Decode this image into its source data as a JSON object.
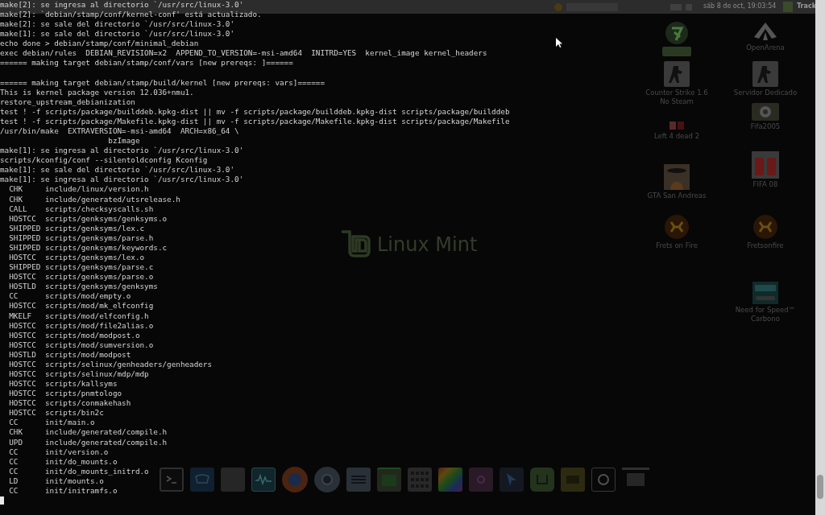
{
  "top_panel": {
    "clock": "sáb 8 de oct, 19:03:54",
    "window_button": "Track"
  },
  "desktop": {
    "logo_text": "Linux Mint",
    "icons": [
      {
        "selected": true,
        "kind": "green"
      },
      {
        "label": "OpenArena",
        "selected": false,
        "kind": "arena"
      },
      {
        "label": "Counter Strike 1.6\nNo Steam",
        "selected": false,
        "kind": "soldier"
      },
      {
        "label": "Servidor Dedicado",
        "selected": false,
        "kind": "soldier"
      },
      {
        "label": "Fifa2005",
        "selected": false,
        "kind": "ball"
      },
      {
        "label": "Left 4 dead 2",
        "selected": false,
        "kind": "l4d"
      },
      {
        "label": "FIFA 08",
        "selected": false,
        "kind": "fifa"
      },
      {
        "label": "GTA San Andreas",
        "selected": false,
        "kind": "gta"
      },
      {
        "label": "Frets on Fire",
        "selected": false,
        "kind": "frets"
      },
      {
        "label": "Fretsonfire",
        "selected": false,
        "kind": "frets"
      },
      {
        "label": "Need for Speed™\nCarbono",
        "selected": false,
        "kind": "nfs"
      }
    ]
  },
  "terminal": {
    "paragraphs": [
      [
        "make[2]: se ingresa al directorio `/usr/src/linux-3.0'",
        "make[2]: `debian/stamp/conf/kernel-conf' está actualizado.",
        "make[2]: se sale del directorio `/usr/src/linux-3.0'",
        "make[1]: se sale del directorio `/usr/src/linux-3.0'",
        "echo done > debian/stamp/conf/minimal_debian",
        "exec debian/rules  DEBIAN_REVISION=x2  APPEND_TO_VERSION=-msi-amd64  INITRD=YES  kernel_image kernel_headers",
        "====== making target debian/stamp/conf/vars [new prereqs: ]======"
      ],
      [
        "====== making target debian/stamp/build/kernel [new prereqs: vars]======",
        "This is kernel package version 12.036+nmu1.",
        "restore_upstream_debianization",
        "test ! -f scripts/package/builddeb.kpkg-dist || mv -f scripts/package/builddeb.kpkg-dist scripts/package/builddeb",
        "test ! -f scripts/package/Makefile.kpkg-dist || mv -f scripts/package/Makefile.kpkg-dist scripts/package/Makefile",
        "/usr/bin/make  EXTRAVERSION=-msi-amd64  ARCH=x86_64 \\",
        "                        bzImage",
        "make[1]: se ingresa al directorio `/usr/src/linux-3.0'",
        "scripts/kconfig/conf --silentoldconfig Kconfig",
        "make[1]: se sale del directorio `/usr/src/linux-3.0'",
        "make[1]: se ingresa al directorio `/usr/src/linux-3.0'",
        "  CHK     include/linux/version.h",
        "  CHK     include/generated/utsrelease.h",
        "  CALL    scripts/checksyscalls.sh",
        "  HOSTCC  scripts/genksyms/genksyms.o",
        "  SHIPPED scripts/genksyms/lex.c",
        "  SHIPPED scripts/genksyms/parse.h",
        "  SHIPPED scripts/genksyms/keywords.c",
        "  HOSTCC  scripts/genksyms/lex.o",
        "  SHIPPED scripts/genksyms/parse.c",
        "  HOSTCC  scripts/genksyms/parse.o",
        "  HOSTLD  scripts/genksyms/genksyms",
        "  CC      scripts/mod/empty.o",
        "  HOSTCC  scripts/mod/mk_elfconfig",
        "  MKELF   scripts/mod/elfconfig.h",
        "  HOSTCC  scripts/mod/file2alias.o",
        "  HOSTCC  scripts/mod/modpost.o",
        "  HOSTCC  scripts/mod/sumversion.o",
        "  HOSTLD  scripts/mod/modpost",
        "  HOSTCC  scripts/selinux/genheaders/genheaders",
        "  HOSTCC  scripts/selinux/mdp/mdp",
        "  HOSTCC  scripts/kallsyms",
        "  HOSTCC  scripts/pnmtologo",
        "  HOSTCC  scripts/conmakehash",
        "  HOSTCC  scripts/bin2c",
        "  CC      init/main.o",
        "  CHK     include/generated/compile.h",
        "  UPD     include/generated/compile.h",
        "  CC      init/version.o",
        "  CC      init/do_mounts.o",
        "  CC      init/do_mounts_initrd.o",
        "  LD      init/mounts.o",
        "  CC      init/initramfs.o"
      ]
    ]
  },
  "dock": {
    "items": [
      {
        "kind": "terminal"
      },
      {
        "kind": "wiper"
      },
      {
        "kind": "grey"
      },
      {
        "kind": "monitor"
      },
      {
        "kind": "firefox"
      },
      {
        "kind": "chrome"
      },
      {
        "kind": "writer"
      },
      {
        "kind": "calc"
      },
      {
        "kind": "grid"
      },
      {
        "kind": "colors"
      },
      {
        "kind": "smile"
      },
      {
        "kind": "cursor"
      },
      {
        "kind": "mint"
      },
      {
        "kind": "photo"
      },
      {
        "kind": "power"
      },
      {
        "kind": "window"
      }
    ]
  }
}
